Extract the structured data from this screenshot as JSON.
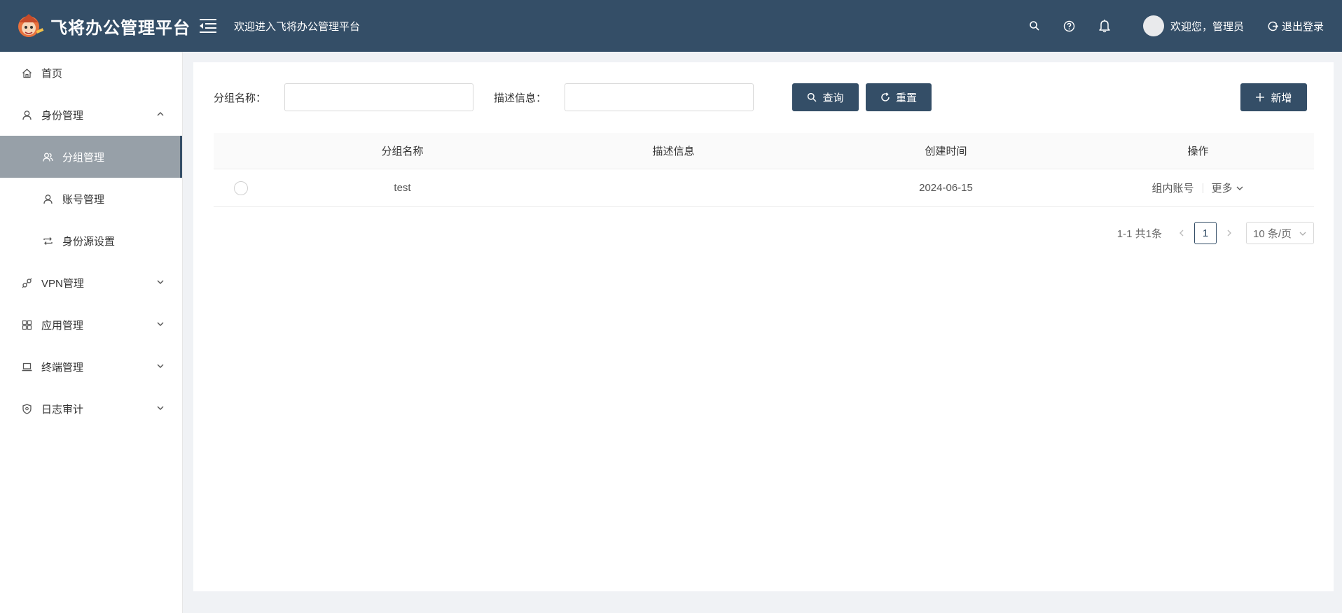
{
  "header": {
    "title": "飞将办公管理平台",
    "welcome": "欢迎进入飞将办公管理平台",
    "user_greeting": "欢迎您，管理员",
    "logout_label": "退出登录",
    "bg_color": "#344e67"
  },
  "sidebar": {
    "items": [
      {
        "label": "首页",
        "icon": "home-icon"
      },
      {
        "label": "身份管理",
        "icon": "user-icon",
        "expanded": true
      },
      {
        "label": "分组管理",
        "icon": "group-icon",
        "active": true
      },
      {
        "label": "账号管理",
        "icon": "user-icon"
      },
      {
        "label": "身份源设置",
        "icon": "sync-icon"
      },
      {
        "label": "VPN管理",
        "icon": "link-icon"
      },
      {
        "label": "应用管理",
        "icon": "grid-icon"
      },
      {
        "label": "终端管理",
        "icon": "laptop-icon"
      },
      {
        "label": "日志审计",
        "icon": "shield-icon"
      }
    ]
  },
  "search": {
    "group_name_label": "分组名称：",
    "group_name_value": "",
    "desc_label": "描述信息：",
    "desc_value": "",
    "query_label": "查询",
    "reset_label": "重置",
    "add_label": "新增"
  },
  "table": {
    "columns": [
      "分组名称",
      "描述信息",
      "创建时间",
      "操作"
    ],
    "rows": [
      {
        "name": "test",
        "desc": "",
        "created": "2024-06-15",
        "op_accounts": "组内账号",
        "op_more": "更多"
      }
    ]
  },
  "pagination": {
    "summary": "1-1 共1条",
    "current_page": "1",
    "page_size": "10 条/页"
  }
}
